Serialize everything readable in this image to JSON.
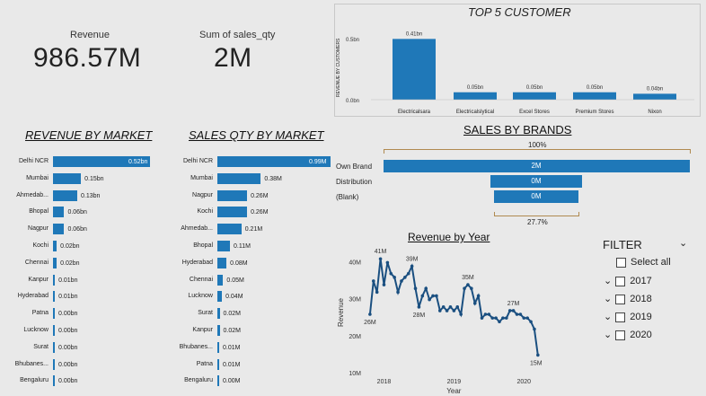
{
  "kpis": {
    "revenue_label": "Revenue",
    "revenue_value": "986.57M",
    "qty_label": "Sum of sales_qty",
    "qty_value": "2M"
  },
  "top5": {
    "title": "TOP 5 CUSTOMER",
    "ylabel": "REVENUE BY CUSTOMERS",
    "ticks": [
      "0.5bn",
      "0.0bn"
    ],
    "customers": [
      {
        "name": "Electricalsara\nStores",
        "value": 0.41,
        "label": "0.41bn"
      },
      {
        "name": "Electricalslytical",
        "value": 0.05,
        "label": "0.05bn"
      },
      {
        "name": "Excel Stores",
        "value": 0.05,
        "label": "0.05bn"
      },
      {
        "name": "Premium Stores",
        "value": 0.05,
        "label": "0.05bn"
      },
      {
        "name": "Nixon",
        "value": 0.04,
        "label": "0.04bn"
      }
    ]
  },
  "rev_market": {
    "title": "REVENUE BY MARKET",
    "rows": [
      {
        "cat": "Delhi NCR",
        "value": 0.52,
        "label": "0.52bn"
      },
      {
        "cat": "Mumbai",
        "value": 0.15,
        "label": "0.15bn"
      },
      {
        "cat": "Ahmedab...",
        "value": 0.13,
        "label": "0.13bn"
      },
      {
        "cat": "Bhopal",
        "value": 0.06,
        "label": "0.06bn"
      },
      {
        "cat": "Nagpur",
        "value": 0.06,
        "label": "0.06bn"
      },
      {
        "cat": "Kochi",
        "value": 0.02,
        "label": "0.02bn"
      },
      {
        "cat": "Chennai",
        "value": 0.02,
        "label": "0.02bn"
      },
      {
        "cat": "Kanpur",
        "value": 0.01,
        "label": "0.01bn"
      },
      {
        "cat": "Hyderabad",
        "value": 0.01,
        "label": "0.01bn"
      },
      {
        "cat": "Patna",
        "value": 0.0,
        "label": "0.00bn"
      },
      {
        "cat": "Lucknow",
        "value": 0.0,
        "label": "0.00bn"
      },
      {
        "cat": "Surat",
        "value": 0.0,
        "label": "0.00bn"
      },
      {
        "cat": "Bhubanes...",
        "value": 0.0,
        "label": "0.00bn"
      },
      {
        "cat": "Bengaluru",
        "value": 0.0,
        "label": "0.00bn"
      }
    ]
  },
  "qty_market": {
    "title": "SALES QTY BY MARKET",
    "rows": [
      {
        "cat": "Delhi NCR",
        "value": 0.99,
        "label": "0.99M"
      },
      {
        "cat": "Mumbai",
        "value": 0.38,
        "label": "0.38M"
      },
      {
        "cat": "Nagpur",
        "value": 0.26,
        "label": "0.26M"
      },
      {
        "cat": "Kochi",
        "value": 0.26,
        "label": "0.26M"
      },
      {
        "cat": "Ahmedab...",
        "value": 0.21,
        "label": "0.21M"
      },
      {
        "cat": "Bhopal",
        "value": 0.11,
        "label": "0.11M"
      },
      {
        "cat": "Hyderabad",
        "value": 0.08,
        "label": "0.08M"
      },
      {
        "cat": "Chennai",
        "value": 0.05,
        "label": "0.05M"
      },
      {
        "cat": "Lucknow",
        "value": 0.04,
        "label": "0.04M"
      },
      {
        "cat": "Surat",
        "value": 0.02,
        "label": "0.02M"
      },
      {
        "cat": "Kanpur",
        "value": 0.02,
        "label": "0.02M"
      },
      {
        "cat": "Bhubanes...",
        "value": 0.01,
        "label": "0.01M"
      },
      {
        "cat": "Patna",
        "value": 0.01,
        "label": "0.01M"
      },
      {
        "cat": "Bengaluru",
        "value": 0.0,
        "label": "0.00M"
      }
    ]
  },
  "brands": {
    "title": "SALES BY BRANDS",
    "top_pct": "100%",
    "bottom_pct": "27.7%",
    "rows": [
      {
        "cat": "Own Brand",
        "label": "2M",
        "fraction": 1.0
      },
      {
        "cat": "Distribution",
        "label": "0M",
        "fraction": 0.3
      },
      {
        "cat": "(Blank)",
        "label": "0M",
        "fraction": 0.277
      }
    ]
  },
  "chart_data": {
    "type": "line",
    "title": "Revenue by Year",
    "xlabel": "Year",
    "ylabel": "Revenue",
    "yticks": [
      "40M",
      "30M",
      "20M",
      "10M"
    ],
    "xticks": [
      "2018",
      "2019",
      "2020"
    ],
    "ylim": [
      10,
      43
    ],
    "xlim": [
      2017.75,
      2020.6
    ],
    "points": [
      [
        2017.8,
        26
      ],
      [
        2017.85,
        35
      ],
      [
        2017.9,
        32
      ],
      [
        2017.95,
        41
      ],
      [
        2018.0,
        34
      ],
      [
        2018.05,
        40
      ],
      [
        2018.1,
        37
      ],
      [
        2018.15,
        36
      ],
      [
        2018.2,
        32
      ],
      [
        2018.25,
        35
      ],
      [
        2018.3,
        36
      ],
      [
        2018.35,
        37
      ],
      [
        2018.4,
        39
      ],
      [
        2018.45,
        33
      ],
      [
        2018.5,
        28
      ],
      [
        2018.55,
        31
      ],
      [
        2018.6,
        33
      ],
      [
        2018.65,
        30
      ],
      [
        2018.7,
        31
      ],
      [
        2018.75,
        31
      ],
      [
        2018.8,
        27
      ],
      [
        2018.85,
        28
      ],
      [
        2018.9,
        27
      ],
      [
        2018.95,
        28
      ],
      [
        2019.0,
        27
      ],
      [
        2019.05,
        28
      ],
      [
        2019.1,
        26
      ],
      [
        2019.15,
        33
      ],
      [
        2019.2,
        34
      ],
      [
        2019.25,
        33
      ],
      [
        2019.3,
        29
      ],
      [
        2019.35,
        31
      ],
      [
        2019.4,
        25
      ],
      [
        2019.45,
        26
      ],
      [
        2019.5,
        26
      ],
      [
        2019.55,
        25
      ],
      [
        2019.6,
        25
      ],
      [
        2019.65,
        24
      ],
      [
        2019.7,
        25
      ],
      [
        2019.75,
        25
      ],
      [
        2019.8,
        27
      ],
      [
        2019.85,
        27
      ],
      [
        2019.9,
        26
      ],
      [
        2019.95,
        26
      ],
      [
        2020.0,
        25
      ],
      [
        2020.05,
        25
      ],
      [
        2020.1,
        24
      ],
      [
        2020.15,
        22
      ],
      [
        2020.2,
        15
      ]
    ],
    "annotations": [
      {
        "x": 2017.8,
        "y": 26,
        "text": "26M"
      },
      {
        "x": 2017.95,
        "y": 41,
        "text": "41M"
      },
      {
        "x": 2018.4,
        "y": 39,
        "text": "39M"
      },
      {
        "x": 2018.5,
        "y": 28,
        "text": "28M"
      },
      {
        "x": 2019.2,
        "y": 34,
        "text": "35M"
      },
      {
        "x": 2019.85,
        "y": 27,
        "text": "27M"
      },
      {
        "x": 2020.2,
        "y": 15,
        "text": "15M"
      }
    ]
  },
  "filter": {
    "title": "FILTER",
    "items": [
      {
        "label": "Select all",
        "expand": false
      },
      {
        "label": "2017",
        "expand": true
      },
      {
        "label": "2018",
        "expand": true
      },
      {
        "label": "2019",
        "expand": true
      },
      {
        "label": "2020",
        "expand": true
      }
    ]
  }
}
